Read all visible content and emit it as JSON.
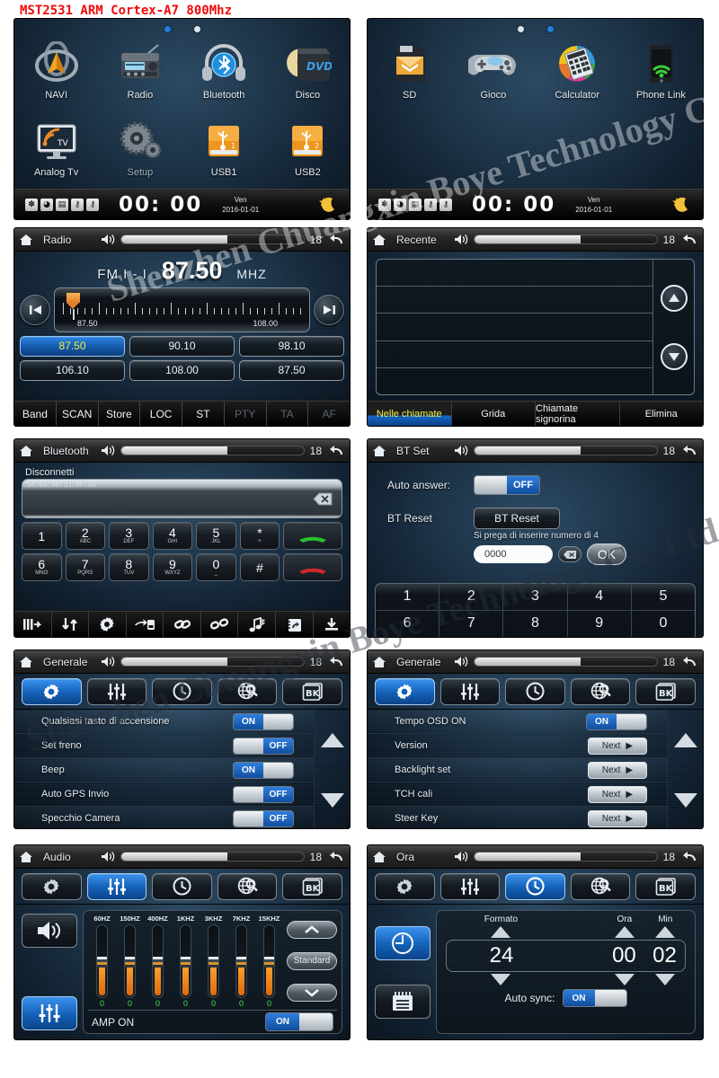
{
  "header": {
    "title": "MST2531 ARM Cortex-A7 800Mhz",
    "color": "#f00a0a"
  },
  "watermark": {
    "line1": "Shenzhen Chuangxin Boye Technology Co. Ltd.",
    "line2": "Shenzhen Chuangxin Boye Technology Co. Ltd."
  },
  "home_left": {
    "icons": [
      {
        "label": "NAVI",
        "icon": "navi-icon"
      },
      {
        "label": "Radio",
        "icon": "radio-icon"
      },
      {
        "label": "Bluetooth",
        "icon": "bluetooth-icon"
      },
      {
        "label": "Disco",
        "icon": "dvd-icon"
      },
      {
        "label": "Analog Tv",
        "icon": "tv-icon"
      },
      {
        "label": "Setup",
        "icon": "gears-icon"
      },
      {
        "label": "USB1",
        "icon": "usb-icon"
      },
      {
        "label": "USB2",
        "icon": "usb-icon"
      }
    ],
    "status": {
      "icons": [
        "bluetooth-status-icon",
        "clock-status-icon",
        "file-status-icon",
        "usb1-status-icon",
        "usb2-status-icon"
      ],
      "clock": "00: 00",
      "weekday": "Ven",
      "date": "2016-01-01",
      "night_icon": "moon-star-icon"
    }
  },
  "home_right": {
    "icons": [
      {
        "label": "SD",
        "icon": "sd-card-icon"
      },
      {
        "label": "Gioco",
        "icon": "gamepad-icon"
      },
      {
        "label": "Calculator",
        "icon": "calculator-icon"
      },
      {
        "label": "Phone Link",
        "icon": "phone-link-icon"
      }
    ],
    "status": {
      "clock": "00: 00",
      "weekday": "Ven",
      "date": "2016-01-01",
      "night_icon": "moon-star-icon"
    }
  },
  "radio": {
    "title": "Radio",
    "volume": "18",
    "band": "FM I - I",
    "frequency": "87.50",
    "unit": "MHZ",
    "dial_min": "87.50",
    "dial_max": "108.00",
    "presets": [
      "87.50",
      "90.10",
      "98.10",
      "106.10",
      "108.00",
      "87.50"
    ],
    "selected_preset": 0,
    "footer": [
      {
        "label": "Band",
        "enabled": true
      },
      {
        "label": "SCAN",
        "enabled": true
      },
      {
        "label": "Store",
        "enabled": true
      },
      {
        "label": "LOC",
        "enabled": true
      },
      {
        "label": "ST",
        "enabled": true
      },
      {
        "label": "PTY",
        "enabled": false
      },
      {
        "label": "TA",
        "enabled": false
      },
      {
        "label": "AF",
        "enabled": false
      }
    ]
  },
  "recente": {
    "title": "Recente",
    "volume": "18",
    "rows": [
      "",
      "",
      "",
      "",
      ""
    ],
    "tabs": [
      "Nelle chiamate",
      "Grida",
      "Chiamate signorina",
      "Elimina"
    ],
    "selected_tab": 0
  },
  "bluetooth": {
    "title": "Bluetooth",
    "volume": "18",
    "status_label": "Disconnetti",
    "mac": "34:60:60:33:9F:60",
    "keys": [
      {
        "num": "1",
        "sub": ""
      },
      {
        "num": "2",
        "sub": "ABC"
      },
      {
        "num": "3",
        "sub": "DEF"
      },
      {
        "num": "4",
        "sub": "GHI"
      },
      {
        "num": "5",
        "sub": "JKL"
      },
      {
        "num": "*",
        "sub": "+"
      },
      {
        "num": "6",
        "sub": "MNO"
      },
      {
        "num": "7",
        "sub": "PQRS"
      },
      {
        "num": "8",
        "sub": "TUV"
      },
      {
        "num": "9",
        "sub": "WXYZ"
      },
      {
        "num": "0",
        "sub": "_"
      },
      {
        "num": "#",
        "sub": ""
      }
    ],
    "toolbar": [
      "dialpad-icon",
      "recent-calls-icon",
      "bt-settings-icon",
      "transfer-call-icon",
      "link-icon",
      "unlink-icon",
      "bt-music-icon",
      "phonebook-icon",
      "download-icon"
    ]
  },
  "btset": {
    "title": "BT Set",
    "volume": "18",
    "auto_answer_label": "Auto answer:",
    "auto_answer_value": "OFF",
    "bt_reset_label": "BT Reset",
    "bt_reset_button": "BT Reset",
    "pin_hint": "Si prega di inserire numero di 4",
    "pin_value": "0000",
    "ok_label": "OK",
    "numpad": [
      "1",
      "2",
      "3",
      "4",
      "5",
      "6",
      "7",
      "8",
      "9",
      "0"
    ]
  },
  "settings_tabs": [
    {
      "name": "general",
      "icon": "gear-icon"
    },
    {
      "name": "audio",
      "icon": "equalizer-icon"
    },
    {
      "name": "time",
      "icon": "clock-icon"
    },
    {
      "name": "language",
      "icon": "globe-search-icon"
    },
    {
      "name": "backup",
      "icon": "bk-icon"
    }
  ],
  "generale_left": {
    "title": "Generale",
    "volume": "18",
    "selected_tab": 0,
    "rows": [
      {
        "label": "Qualsiasi tasto di accensione",
        "type": "toggle",
        "value": "ON"
      },
      {
        "label": "Set freno",
        "type": "toggle",
        "value": "OFF"
      },
      {
        "label": "Beep",
        "type": "toggle",
        "value": "ON"
      },
      {
        "label": "Auto GPS Invio",
        "type": "toggle",
        "value": "OFF"
      },
      {
        "label": "Specchio Camera",
        "type": "toggle",
        "value": "OFF"
      }
    ]
  },
  "generale_right": {
    "title": "Generale",
    "volume": "18",
    "selected_tab": 0,
    "rows": [
      {
        "label": "Tempo OSD ON",
        "type": "toggle",
        "value": "ON"
      },
      {
        "label": "Version",
        "type": "next",
        "value": "Next"
      },
      {
        "label": "Backlight set",
        "type": "next",
        "value": "Next"
      },
      {
        "label": "TCH cali",
        "type": "next",
        "value": "Next"
      },
      {
        "label": "Steer Key",
        "type": "next",
        "value": "Next"
      }
    ]
  },
  "audio": {
    "title": "Audio",
    "volume": "18",
    "selected_tab": 1,
    "side_buttons": [
      "speaker-icon",
      "equalizer-icon"
    ],
    "preset_label": "Standard",
    "amp_label": "AMP ON",
    "amp_value": "ON",
    "bands": [
      "60HZ",
      "150HZ",
      "400HZ",
      "1KHZ",
      "3KHZ",
      "7KHZ",
      "15KHZ"
    ],
    "values": [
      "0",
      "0",
      "0",
      "0",
      "0",
      "0",
      "0"
    ]
  },
  "ora": {
    "title": "Ora",
    "volume": "18",
    "selected_tab": 2,
    "side_buttons": [
      "clock-icon",
      "calendar-icon"
    ],
    "format_label": "Formato",
    "hour_label": "Ora",
    "min_label": "Min",
    "format_value": "24",
    "hour_value": "00",
    "min_value": "02",
    "sync_label": "Auto sync:",
    "sync_value": "ON"
  }
}
